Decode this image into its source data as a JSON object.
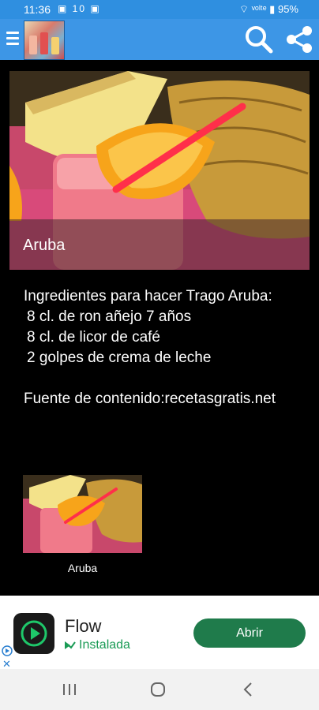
{
  "status_bar": {
    "time": "11:36",
    "notif_icons": "▣ 10 ▣",
    "battery": "95%",
    "signal_text": "⌔ ᵛᵒˡᵗᵉ ▮"
  },
  "app_bar": {
    "menu_icon": "hamburger-icon",
    "search_icon": "search-icon",
    "share_icon": "share-icon"
  },
  "recipe": {
    "title": "Aruba",
    "ingredients_heading": "Ingredientes para hacer Trago Aruba:",
    "ingredients": [
      "8 cl. de ron añejo 7 años",
      "8 cl. de licor de café",
      "2 golpes de crema de leche"
    ],
    "source_label": "Fuente de contenido:recetasgratis.net",
    "related_label": "Aruba"
  },
  "ad": {
    "app_name": "Flow",
    "status": "Instalada",
    "button_label": "Abrir",
    "close_label": "✕"
  },
  "colors": {
    "app_bar": "#3d96e6",
    "status_bar": "#2f8fe0",
    "background": "#000000",
    "ad_button": "#1f7b4b",
    "ad_status": "#1a9b55"
  }
}
